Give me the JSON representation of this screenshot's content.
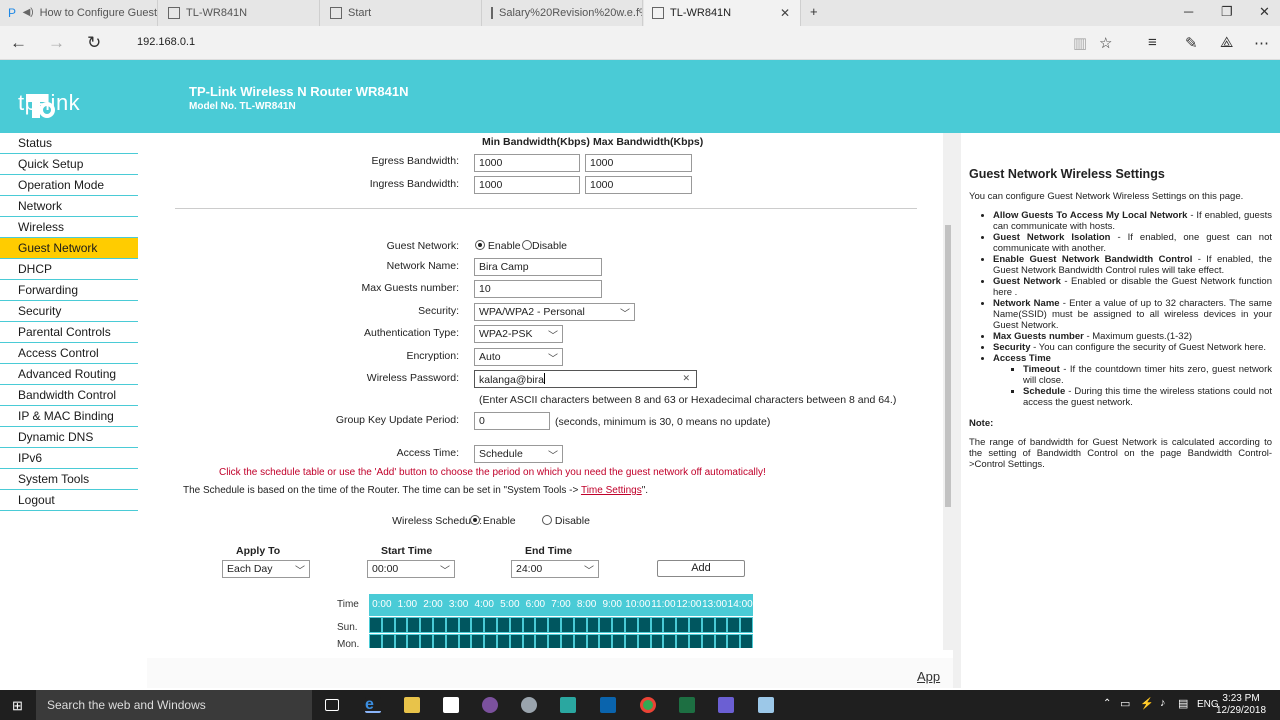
{
  "browser": {
    "tabs": [
      {
        "title": "How to Configure Guest"
      },
      {
        "title": "TL-WR841N"
      },
      {
        "title": "Start"
      },
      {
        "title": "Salary%20Revision%20w.e.f%"
      },
      {
        "title": "TL-WR841N"
      }
    ],
    "new_tab": "+",
    "url": "192.168.0.1"
  },
  "router": {
    "logo_text": "tp-link",
    "title": "TP-Link Wireless N Router WR841N",
    "model": "Model No. TL-WR841N"
  },
  "sidebar": {
    "items": [
      {
        "label": "Status"
      },
      {
        "label": "Quick Setup"
      },
      {
        "label": "Operation Mode"
      },
      {
        "label": "Network"
      },
      {
        "label": "Wireless"
      },
      {
        "label": "Guest Network"
      },
      {
        "label": "DHCP"
      },
      {
        "label": "Forwarding"
      },
      {
        "label": "Security"
      },
      {
        "label": "Parental Controls"
      },
      {
        "label": "Access Control"
      },
      {
        "label": "Advanced Routing"
      },
      {
        "label": "Bandwidth Control"
      },
      {
        "label": "IP & MAC Binding"
      },
      {
        "label": "Dynamic DNS"
      },
      {
        "label": "IPv6"
      },
      {
        "label": "System Tools"
      },
      {
        "label": "Logout"
      }
    ],
    "active": "Guest Network"
  },
  "form": {
    "min_bw_header": "Min Bandwidth(Kbps)",
    "max_bw_header": "Max Bandwidth(Kbps)",
    "egress_label": "Egress Bandwidth:",
    "egress_min": "1000",
    "egress_max": "1000",
    "ingress_label": "Ingress Bandwidth:",
    "ingress_min": "1000",
    "ingress_max": "1000",
    "guest_network_label": "Guest Network:",
    "enable": "Enable",
    "disable": "Disable",
    "network_name_label": "Network Name:",
    "network_name": "Bira Camp",
    "max_guests_label": "Max Guests number:",
    "max_guests": "10",
    "security_label": "Security:",
    "security": "WPA/WPA2 - Personal",
    "auth_label": "Authentication Type:",
    "auth": "WPA2-PSK",
    "encryption_label": "Encryption:",
    "encryption": "Auto",
    "password_label": "Wireless Password:",
    "password": "kalanga@bira",
    "password_hint": "(Enter ASCII characters between 8 and 63 or Hexadecimal characters between 8 and 64.)",
    "gkup_label": "Group Key Update Period:",
    "gkup": "0",
    "gkup_hint": "(seconds, minimum is 30, 0 means no update)",
    "access_time_label": "Access Time:",
    "access_time": "Schedule",
    "schedule_note": "Click the schedule table or use the 'Add' button to choose the period on which you need the guest network off automatically!",
    "schedule_time_note": "The Schedule is based on the time of the Router. The time can be set in \"System Tools -> ",
    "time_settings_link": "Time Settings",
    "schedule_time_note_end": "\".",
    "wireless_schedule_label": "Wireless Schedule:",
    "apply_to_header": "Apply To",
    "start_time_header": "Start Time",
    "end_time_header": "End Time",
    "apply_to": "Each Day",
    "start_time": "00:00",
    "end_time": "24:00",
    "add_button": "Add",
    "grid_time_label": "Time",
    "grid_hours": [
      "0:00",
      "1:00",
      "2:00",
      "3:00",
      "4:00",
      "5:00",
      "6:00",
      "7:00",
      "8:00",
      "9:00",
      "10:00",
      "11:00",
      "12:00",
      "13:00",
      "14:00"
    ],
    "grid_days": [
      "Sun.",
      "Mon."
    ],
    "apply_link": "App"
  },
  "help": {
    "title": "Guest Network Wireless Settings",
    "intro": "You can configure Guest Network Wireless Settings on this page.",
    "items": [
      {
        "term": "Allow Guests To Access My Local Network",
        "desc": " - If enabled, guests can communicate with hosts."
      },
      {
        "term": "Guest Network Isolation",
        "desc": " - If enabled, one guest can not communicate with another."
      },
      {
        "term": "Enable Guest Network Bandwidth Control",
        "desc": " - If enabled, the Guest Network Bandwidth Control rules will take effect."
      },
      {
        "term": "Guest Network",
        "desc": " - Enabled or disable the Guest Network function here ."
      },
      {
        "term": "Network Name",
        "desc": " - Enter a value of up to 32 characters. The same Name(SSID) must be assigned to all wireless devices in your Guest Network."
      },
      {
        "term": "Max Guests number",
        "desc": " - Maximum guests.(1-32)"
      },
      {
        "term": "Security",
        "desc": " - You can configure the security of Guest Network here."
      },
      {
        "term": "Access Time",
        "desc": ""
      }
    ],
    "sub_items": [
      {
        "term": "Timeout",
        "desc": " - If the countdown timer hits zero, guest network will close."
      },
      {
        "term": "Schedule",
        "desc": " - During this time the wireless stations could not access the guest network."
      }
    ],
    "note_label": "Note:",
    "note_body": "The range of bandwidth for Guest Network is calculated according to the setting of Bandwidth Control on the page Bandwidth Control->Control Settings."
  },
  "taskbar": {
    "search_placeholder": "Search the web and Windows",
    "language": "ENG",
    "time": "3:23 PM",
    "date": "12/29/2018"
  },
  "colors": {
    "brand_teal": "#4acbd6",
    "active_menu": "#ffcc00",
    "grid_cell": "#00565f",
    "warning_red": "#c0002a"
  }
}
